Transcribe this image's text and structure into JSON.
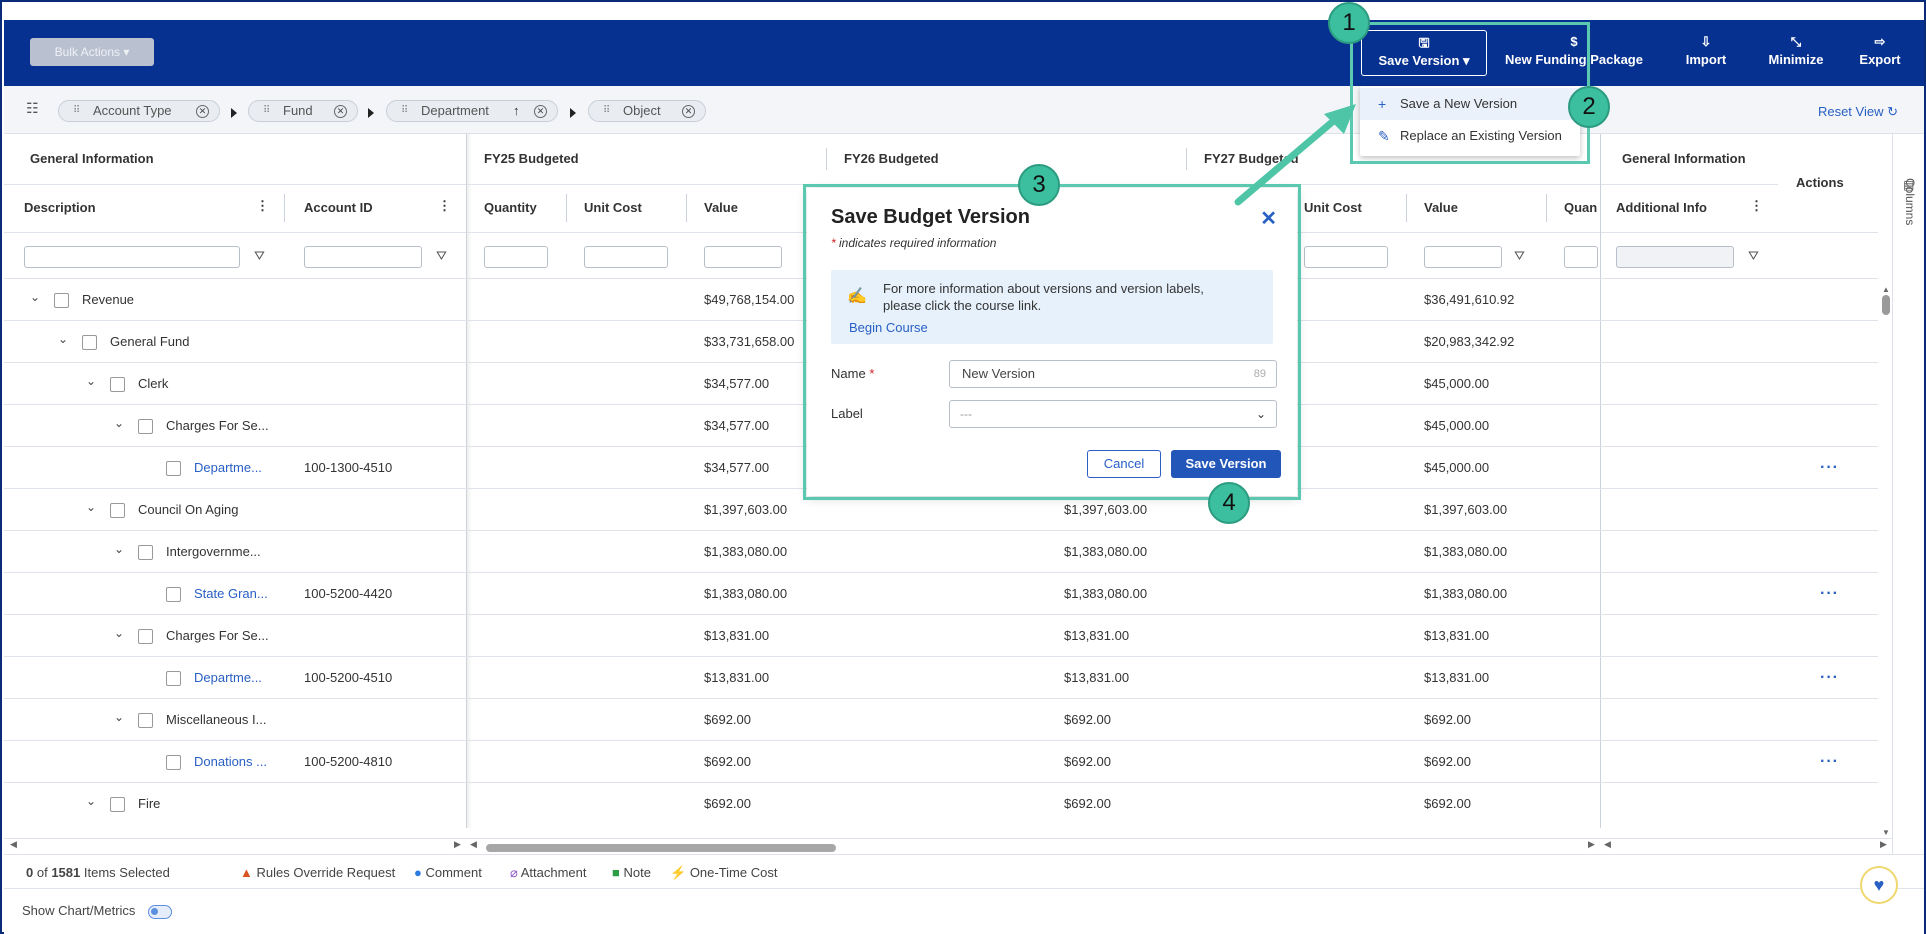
{
  "toolbar": {
    "bulk_actions": "Bulk Actions",
    "save_version": "Save Version",
    "new_funding_package": "New Funding Package",
    "import": "Import",
    "minimize": "Minimize",
    "export": "Export"
  },
  "save_menu": {
    "items": [
      "Save a New Version",
      "Replace an Existing Version"
    ]
  },
  "breadcrumbs": {
    "chips": [
      "Account Type",
      "Fund",
      "Department",
      "Object"
    ],
    "reset_view": "Reset View"
  },
  "grid": {
    "groups": {
      "general_info": "General Information",
      "fy25": "FY25  Budgeted",
      "fy26": "FY26  Budgeted",
      "fy27": "FY27  Budgeted",
      "general_info_right": "General Information",
      "actions": "Actions"
    },
    "columns": {
      "description": "Description",
      "account_id": "Account ID",
      "quantity": "Quantity",
      "unit_cost": "Unit Cost",
      "value": "Value",
      "unit_cost_fy27": "Unit Cost",
      "value_fy27": "Value",
      "quantity_fy28": "Quan",
      "additional_info": "Additional Info"
    },
    "rows": [
      {
        "desc": "Revenue",
        "acct": "",
        "v25": "$49,768,154.00",
        "v26": "",
        "v27": "$36,491,610.92",
        "link": false,
        "actions": false
      },
      {
        "desc": "General Fund",
        "acct": "",
        "v25": "$33,731,658.00",
        "v26": "",
        "v27": "$20,983,342.92",
        "link": false,
        "actions": false
      },
      {
        "desc": "Clerk",
        "acct": "",
        "v25": "$34,577.00",
        "v26": "",
        "v27": "$45,000.00",
        "link": false,
        "actions": false
      },
      {
        "desc": "Charges For Se...",
        "acct": "",
        "v25": "$34,577.00",
        "v26": "",
        "v27": "$45,000.00",
        "link": false,
        "actions": false
      },
      {
        "desc": "Departme...",
        "acct": "100-1300-4510",
        "v25": "$34,577.00",
        "v26": "",
        "v27": "$45,000.00",
        "link": true,
        "actions": true
      },
      {
        "desc": "Council On Aging",
        "acct": "",
        "v25": "$1,397,603.00",
        "v26": "$1,397,603.00",
        "v27": "$1,397,603.00",
        "link": false,
        "actions": false
      },
      {
        "desc": "Intergovernme...",
        "acct": "",
        "v25": "$1,383,080.00",
        "v26": "$1,383,080.00",
        "v27": "$1,383,080.00",
        "link": false,
        "actions": false
      },
      {
        "desc": "State Gran...",
        "acct": "100-5200-4420",
        "v25": "$1,383,080.00",
        "v26": "$1,383,080.00",
        "v27": "$1,383,080.00",
        "link": true,
        "actions": true
      },
      {
        "desc": "Charges For Se...",
        "acct": "",
        "v25": "$13,831.00",
        "v26": "$13,831.00",
        "v27": "$13,831.00",
        "link": false,
        "actions": false
      },
      {
        "desc": "Departme...",
        "acct": "100-5200-4510",
        "v25": "$13,831.00",
        "v26": "$13,831.00",
        "v27": "$13,831.00",
        "link": true,
        "actions": true
      },
      {
        "desc": "Miscellaneous I...",
        "acct": "",
        "v25": "$692.00",
        "v26": "$692.00",
        "v27": "$692.00",
        "link": false,
        "actions": false
      },
      {
        "desc": "Donations ...",
        "acct": "100-5200-4810",
        "v25": "$692.00",
        "v26": "$692.00",
        "v27": "$692.00",
        "link": true,
        "actions": true
      },
      {
        "desc": "Fire",
        "acct": "",
        "v25": "$692.00",
        "v26": "$692.00",
        "v27": "$692.00",
        "link": false,
        "actions": false
      }
    ],
    "actions_glyph": "···"
  },
  "sidebar": {
    "columns_label": "Columns"
  },
  "footer": {
    "selected_count": "0",
    "selected_of": "of",
    "selected_total": "1581",
    "selected_suffix": "Items Selected",
    "legend": [
      "Rules Override Request",
      "Comment",
      "Attachment",
      "Note",
      "One-Time Cost"
    ],
    "show_chart": "Show Chart/Metrics"
  },
  "modal": {
    "title": "Save Budget Version",
    "required_note": "indicates required information",
    "info_text": "For more information about versions and version labels, please click the course link.",
    "begin_course": "Begin Course",
    "name_label": "Name",
    "name_value": "New Version",
    "name_counter": "89",
    "label_label": "Label",
    "label_value": "---",
    "cancel": "Cancel",
    "save": "Save Version"
  },
  "annotations": {
    "badges": [
      "1",
      "2",
      "3",
      "4"
    ]
  },
  "colors": {
    "header": "#073190",
    "accent": "#2960c4",
    "highlight": "#5ac9b0"
  }
}
